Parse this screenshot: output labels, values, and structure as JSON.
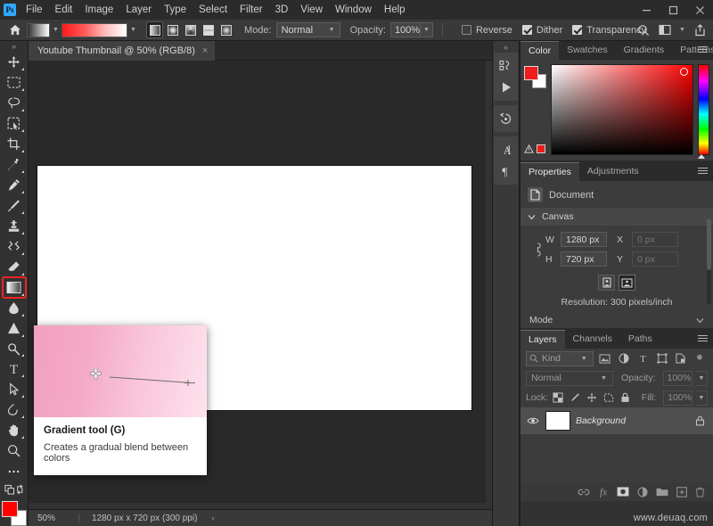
{
  "app": {
    "logo": "ps-logo",
    "menus": [
      "File",
      "Edit",
      "Image",
      "Layer",
      "Type",
      "Select",
      "Filter",
      "3D",
      "View",
      "Window",
      "Help"
    ],
    "window_controls": [
      "minimize-button",
      "maximize-button",
      "close-button"
    ]
  },
  "options_bar": {
    "home_icon": "home-icon",
    "tool_preset_icon": "gradient-tool-preset",
    "gradient_picker_label": "gradient-swatch",
    "gradient_types": [
      "Linear Gradient",
      "Radial Gradient",
      "Angle Gradient",
      "Reflected Gradient",
      "Diamond Gradient"
    ],
    "gradient_type_selected": "Linear Gradient",
    "mode_label": "Mode:",
    "mode_value": "Normal",
    "opacity_label": "Opacity:",
    "opacity_value": "100%",
    "reverse_label": "Reverse",
    "reverse_checked": false,
    "dither_label": "Dither",
    "dither_checked": true,
    "transparency_label": "Transparency",
    "transparency_checked": true,
    "right_icons": [
      "search-icon",
      "workspace-icon",
      "share-icon"
    ]
  },
  "document_tab": {
    "title": "Youtube Thumbnail @ 50% (RGB/8)",
    "close": "×"
  },
  "toolbar": {
    "collapse": "»",
    "tools": [
      {
        "name": "move-tool",
        "label": "Move Tool (V)"
      },
      {
        "name": "rectangular-marquee-tool",
        "label": "Rectangular Marquee Tool (M)"
      },
      {
        "name": "lasso-tool",
        "label": "Lasso Tool (L)"
      },
      {
        "name": "object-selection-tool",
        "label": "Object Selection Tool (W)"
      },
      {
        "name": "crop-tool",
        "label": "Crop Tool (C)"
      },
      {
        "name": "eyedropper-tool",
        "label": "Eyedropper Tool (I)"
      },
      {
        "name": "spot-healing-brush-tool",
        "label": "Spot Healing Brush Tool (J)"
      },
      {
        "name": "brush-tool",
        "label": "Brush Tool (B)"
      },
      {
        "name": "clone-stamp-tool",
        "label": "Clone Stamp Tool (S)"
      },
      {
        "name": "history-brush-tool",
        "label": "History Brush Tool (Y)"
      },
      {
        "name": "eraser-tool",
        "label": "Eraser Tool (E)"
      },
      {
        "name": "gradient-tool",
        "label": "Gradient Tool (G)"
      },
      {
        "name": "blur-tool",
        "label": "Blur Tool"
      },
      {
        "name": "dodge-tool",
        "label": "Dodge Tool (O)"
      },
      {
        "name": "pen-tool",
        "label": "Pen Tool (P)"
      },
      {
        "name": "type-tool",
        "label": "Horizontal Type Tool (T)"
      },
      {
        "name": "path-selection-tool",
        "label": "Path Selection Tool (A)"
      },
      {
        "name": "shape-tool",
        "label": "Rectangle Tool (U)"
      },
      {
        "name": "hand-tool",
        "label": "Hand Tool (H)"
      },
      {
        "name": "zoom-tool",
        "label": "Zoom Tool (Z)"
      },
      {
        "name": "edit-toolbar-button",
        "label": "Edit Toolbar"
      }
    ],
    "selected_tool": "gradient-tool",
    "foreground_color": "#fe0000",
    "background_color": "#ffffff"
  },
  "tooltip": {
    "title": "Gradient tool (G)",
    "description": "Creates a gradual blend between colors",
    "media": "gradient-demo-animation"
  },
  "status_bar": {
    "zoom": "50%",
    "doc_info": "1280 px x 720 px (300 ppi)",
    "expand": "›"
  },
  "mini_dock": {
    "collapse": "«",
    "icons": [
      "libraries-icon",
      "actions-play-icon",
      "history-icon",
      "character-icon",
      "paragraph-icon"
    ]
  },
  "color_panel": {
    "tabs": [
      "Color",
      "Swatches",
      "Gradients",
      "Patterns"
    ],
    "active_tab": "Color",
    "foreground": "#f01c1c",
    "background": "#ffffff",
    "out_of_gamut_icon": "gamut-warning-icon",
    "web_safe_swatch": "#f01c1c"
  },
  "properties_panel": {
    "tabs": [
      "Properties",
      "Adjustments"
    ],
    "active_tab": "Properties",
    "doc_icon": "document-icon",
    "doc_label": "Document",
    "canvas_section": "Canvas",
    "w_label": "W",
    "w_value": "1280 px",
    "h_label": "H",
    "h_value": "720 px",
    "x_label": "X",
    "x_value": "0 px",
    "y_label": "Y",
    "y_value": "0 px",
    "link_icon": "link-dimensions-icon",
    "orientation": [
      "portrait-orientation-button",
      "landscape-orientation-button"
    ],
    "orientation_selected": "landscape-orientation-button",
    "resolution": "Resolution: 300 pixels/inch",
    "mode_section": "Mode"
  },
  "layers_panel": {
    "tabs": [
      "Layers",
      "Channels",
      "Paths"
    ],
    "active_tab": "Layers",
    "kind_filter": "Kind",
    "filter_icons": [
      "filter-pixel-icon",
      "filter-adjustment-icon",
      "filter-type-icon",
      "filter-shape-icon",
      "filter-smart-object-icon",
      "filter-toggle-icon"
    ],
    "blend_mode": "Normal",
    "opacity_label": "Opacity:",
    "opacity_value": "100%",
    "lock_label": "Lock:",
    "lock_icons": [
      "lock-transparent-pixels-icon",
      "lock-image-pixels-icon",
      "lock-position-icon",
      "lock-artboard-nesting-icon",
      "lock-all-icon"
    ],
    "fill_label": "Fill:",
    "fill_value": "100%",
    "layers": [
      {
        "name": "Background",
        "visible": true,
        "locked": true,
        "thumb": "#ffffff"
      }
    ],
    "footer_icons": [
      "link-layers-icon",
      "add-layer-style-icon",
      "add-layer-mask-icon",
      "new-fill-adjustment-icon",
      "new-group-icon",
      "new-layer-icon",
      "delete-layer-icon"
    ]
  },
  "watermark": "www.deuaq.com"
}
